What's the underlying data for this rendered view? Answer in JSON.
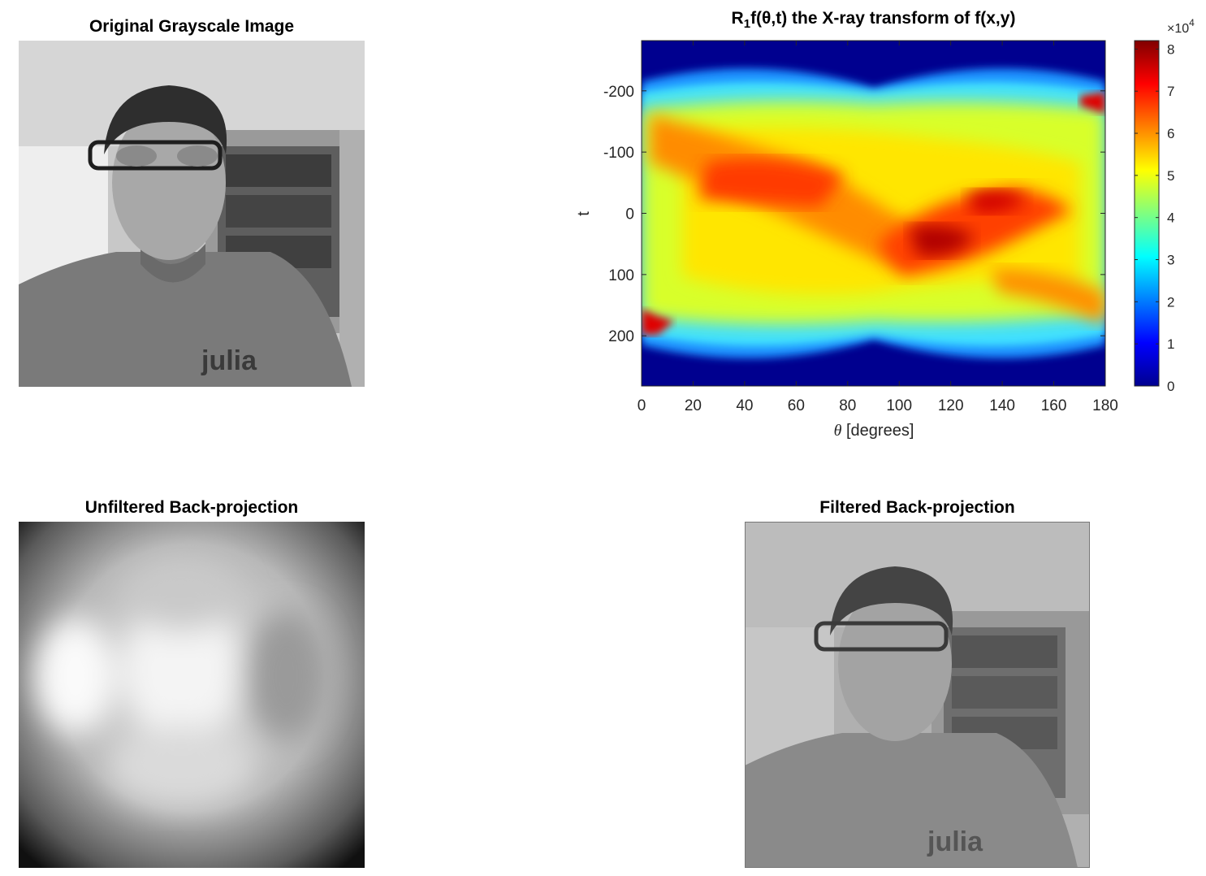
{
  "panels": {
    "original": {
      "title": "Original Grayscale Image"
    },
    "sinogram": {
      "title_main": "R",
      "title_sub": "1",
      "title_rest": "f(θ,t) the X-ray transform of f(x,y)"
    },
    "unfiltered": {
      "title": "Unfiltered Back-projection"
    },
    "filtered": {
      "title": "Filtered Back-projection"
    }
  },
  "chart_data": {
    "type": "heatmap",
    "title": "R1f(θ,t) the X-ray transform of f(x,y)",
    "xlabel_symbol": "θ",
    "xlabel_text": "[degrees]",
    "ylabel": "t",
    "xlim": [
      0,
      180
    ],
    "ylim": [
      -282,
      282
    ],
    "y_reversed": true,
    "xticks": [
      0,
      20,
      40,
      60,
      80,
      100,
      120,
      140,
      160,
      180
    ],
    "yticks": [
      -200,
      -100,
      0,
      100,
      200
    ],
    "colorbar": {
      "colormap": "jet",
      "range": [
        0,
        82000
      ],
      "ticks": [
        0,
        1,
        2,
        3,
        4,
        5,
        6,
        7,
        8
      ],
      "exponent_base": "×10",
      "exponent": "4"
    }
  }
}
